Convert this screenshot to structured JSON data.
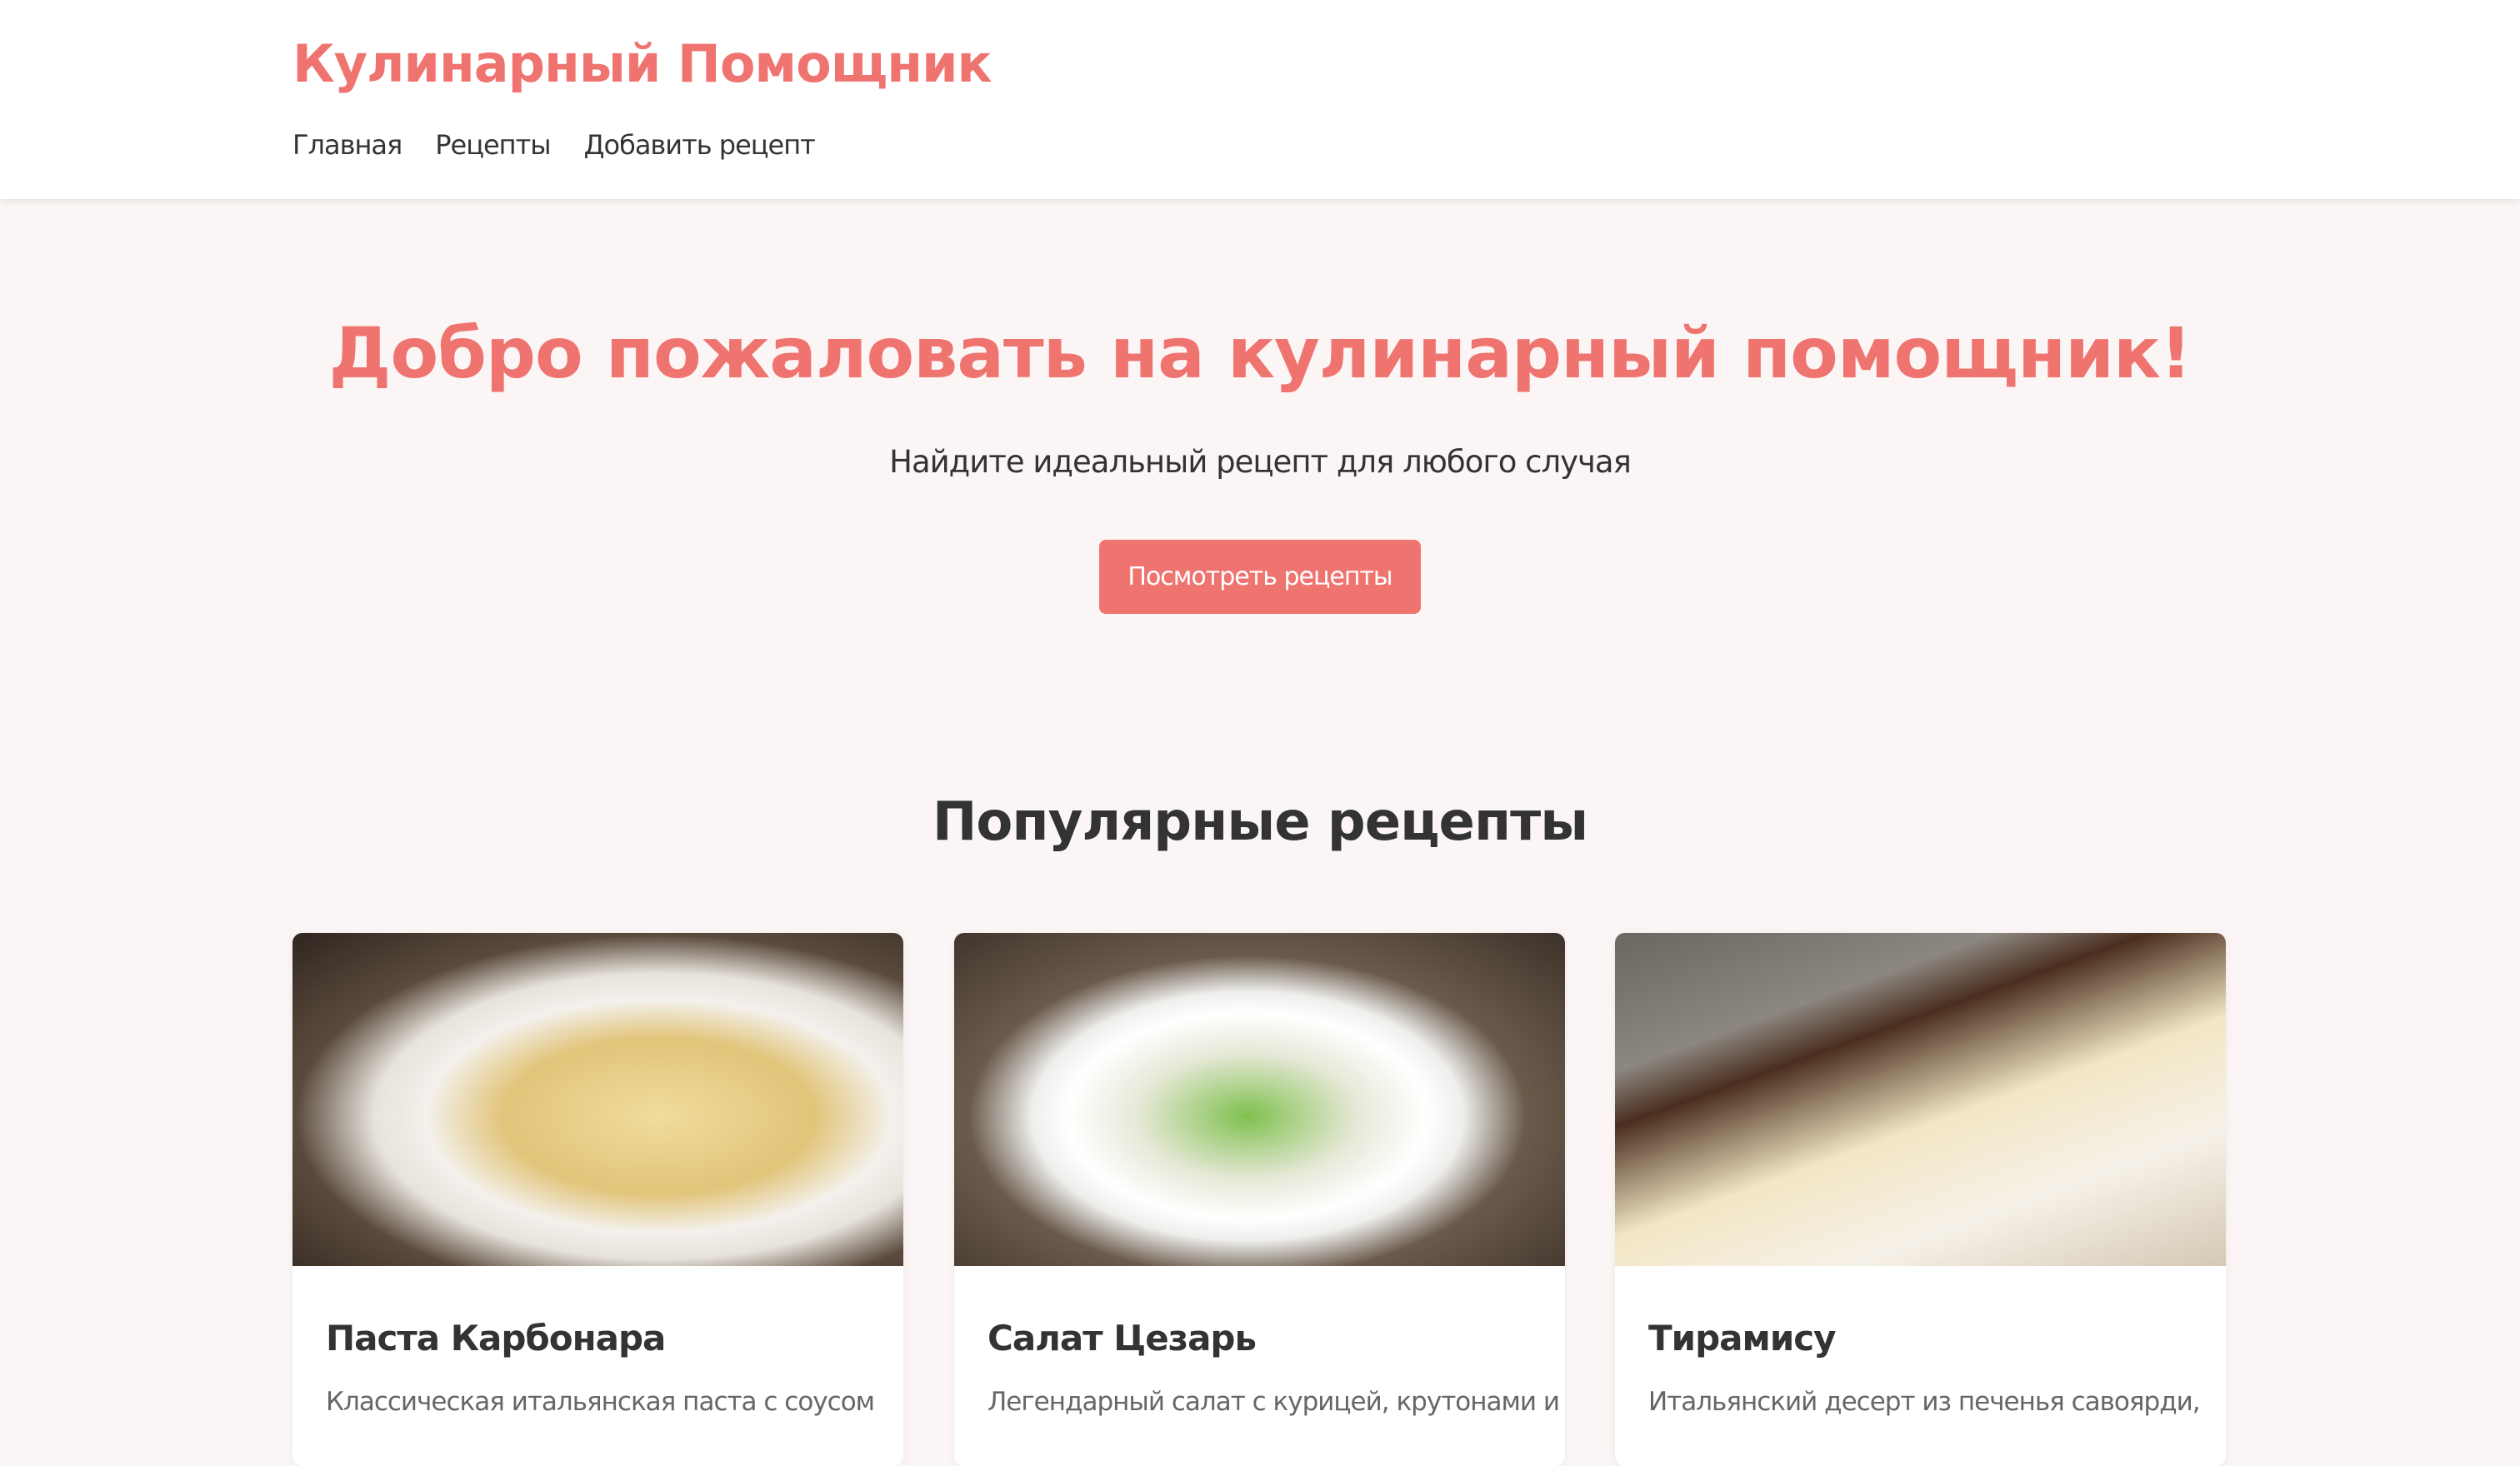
{
  "header": {
    "logo": "Кулинарный Помощник",
    "nav": [
      "Главная",
      "Рецепты",
      "Добавить рецепт"
    ]
  },
  "hero": {
    "title": "Добро пожаловать на кулинарный помощник!",
    "subtitle": "Найдите идеальный рецепт для любого случая",
    "button": "Посмотреть рецепты"
  },
  "popular": {
    "title": "Популярные рецепты",
    "recipes": [
      {
        "title": "Паста Карбонара",
        "description": "Классическая итальянская паста с соусом"
      },
      {
        "title": "Салат Цезарь",
        "description": "Легендарный салат с курицей, крутонами и"
      },
      {
        "title": "Тирамису",
        "description": "Итальянский десерт из печенья савоярди,"
      }
    ]
  },
  "colors": {
    "accent": "#ef7470",
    "text": "#333333",
    "background": "#fbf6f5"
  }
}
